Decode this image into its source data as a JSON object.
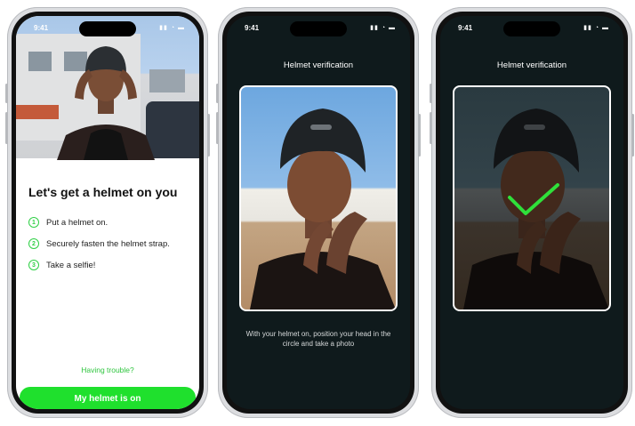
{
  "status": {
    "time": "9:41"
  },
  "screen1": {
    "title": "Let's get a helmet on you",
    "steps": [
      {
        "num": "1",
        "text": "Put a helmet on."
      },
      {
        "num": "2",
        "text": "Securely fasten the helmet strap."
      },
      {
        "num": "3",
        "text": "Take a selfie!"
      }
    ],
    "trouble_link": "Having trouble?",
    "primary_button": "My helmet is on"
  },
  "screen2": {
    "title": "Helmet verification",
    "caption": "With your helmet on, position your head in the circle and take a photo"
  },
  "screen3": {
    "title": "Helmet verification"
  },
  "colors": {
    "accent": "#1fe02d",
    "dark_bg": "#0f1a1c",
    "check": "#2fe03a"
  }
}
